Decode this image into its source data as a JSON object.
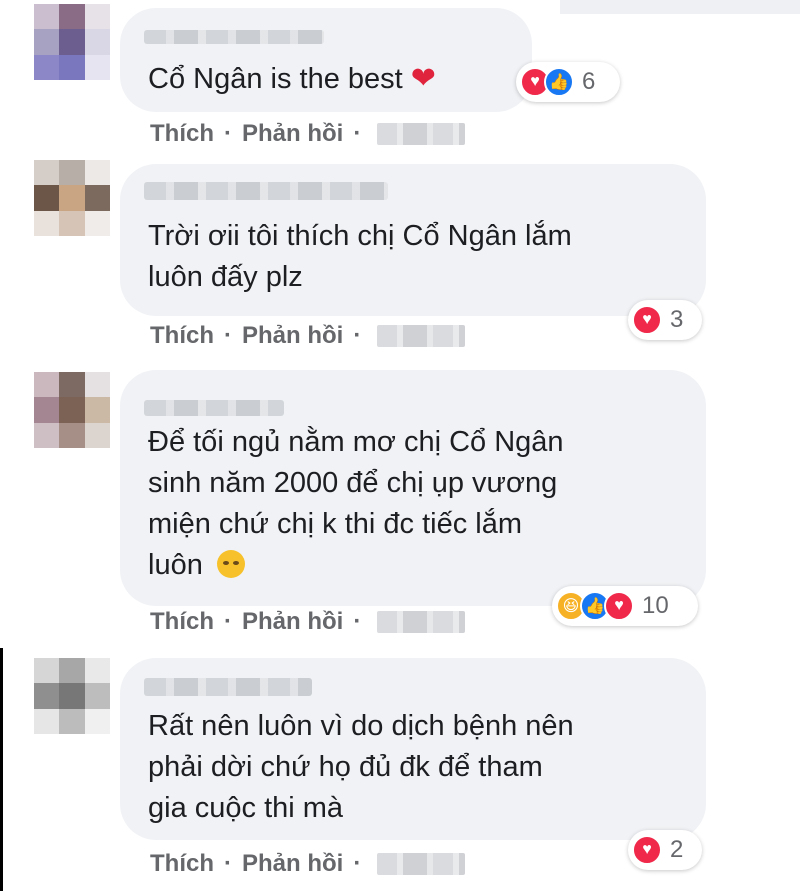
{
  "comments": [
    {
      "text_lines": [
        "Cổ Ngân is the best"
      ],
      "trailing_icon": "red-heart-emoji",
      "reaction_icons": [
        "love-icon",
        "like-icon"
      ],
      "reaction_count": "6",
      "like_label": "Thích",
      "reply_label": "Phản hồi"
    },
    {
      "text_lines": [
        "Trời ơii tôi thích chị Cổ Ngân lắm",
        "luôn đấy plz"
      ],
      "reaction_icons": [
        "love-icon"
      ],
      "reaction_count": "3",
      "like_label": "Thích",
      "reply_label": "Phản hồi"
    },
    {
      "text_lines": [
        "Để tối ngủ nằm mơ chị Cổ Ngân",
        "sinh năm 2000 để chị ụp vương",
        "miện chứ chị k thi đc tiếc lắm",
        "luôn"
      ],
      "trailing_icon": "crying-face-emoji",
      "reaction_icons": [
        "haha-icon",
        "like-icon",
        "love-icon"
      ],
      "reaction_count": "10",
      "like_label": "Thích",
      "reply_label": "Phản hồi"
    },
    {
      "text_lines": [
        "Rất nên luôn vì do dịch bệnh nên",
        "phải dời chứ họ đủ đk để tham",
        "gia cuộc thi mà"
      ],
      "reaction_icons": [
        "love-icon"
      ],
      "reaction_count": "2",
      "like_label": "Thích",
      "reply_label": "Phản hồi"
    }
  ],
  "colors": {
    "bubble": "#f0f2f5",
    "text": "#1c1e21",
    "secondary": "#65676b",
    "love": "#f0284a",
    "like": "#1877f2",
    "haha": "#f7b125"
  }
}
